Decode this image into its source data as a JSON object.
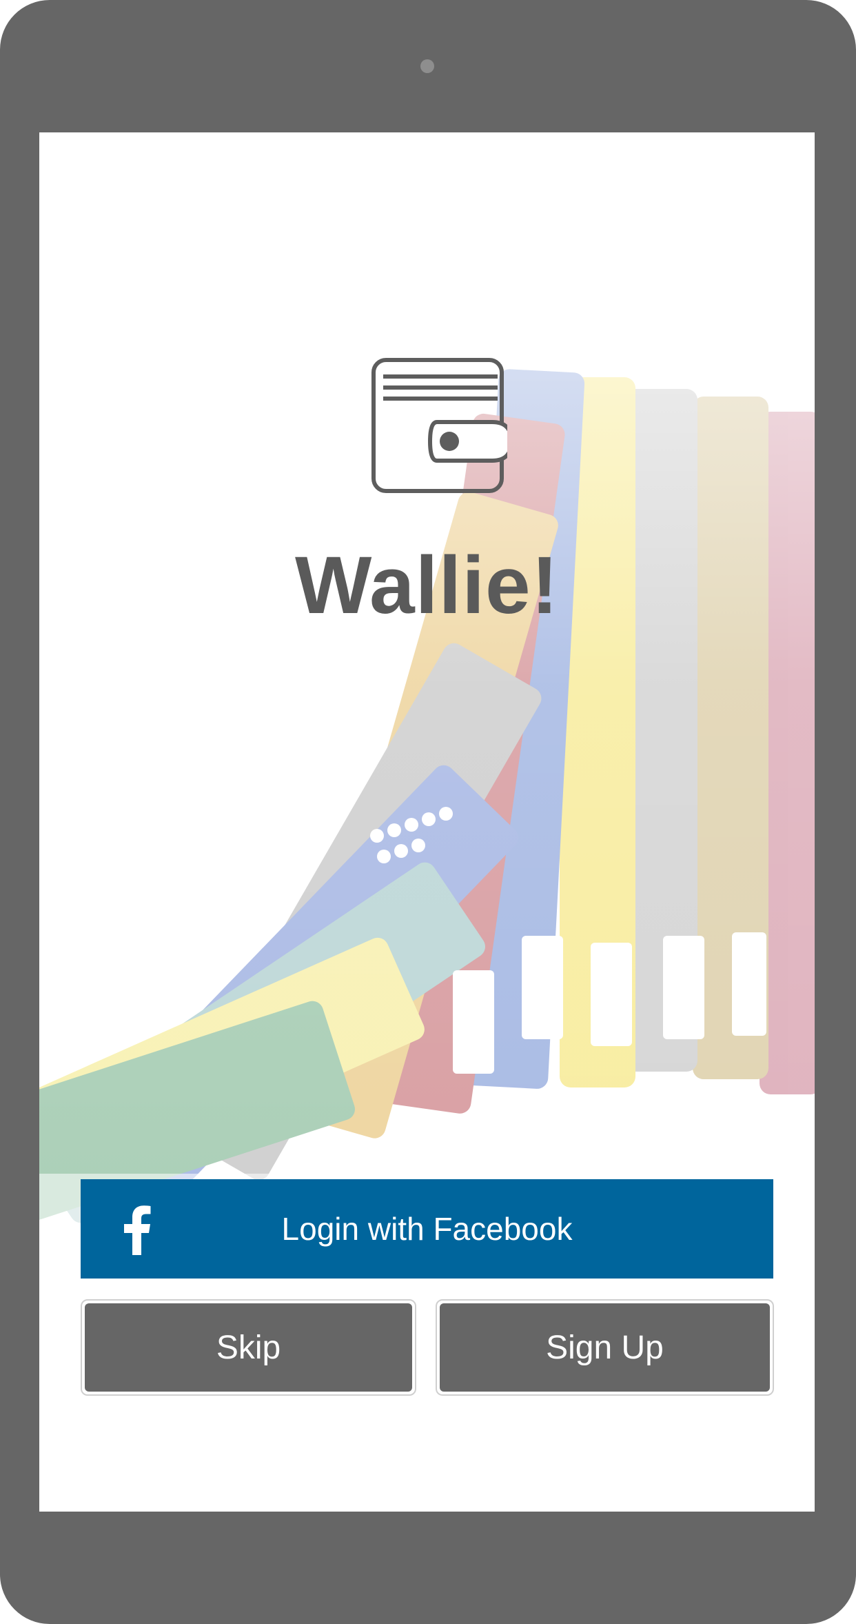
{
  "app": {
    "title": "Wallie!",
    "logo_icon": "wallet-icon"
  },
  "actions": {
    "facebook_login_label": "Login with Facebook",
    "facebook_icon": "facebook-icon",
    "skip_label": "Skip",
    "signup_label": "Sign Up"
  },
  "colors": {
    "device_frame": "#666666",
    "facebook_blue": "#00659c",
    "button_gray": "#666666",
    "title_gray": "#5a5a5a"
  }
}
